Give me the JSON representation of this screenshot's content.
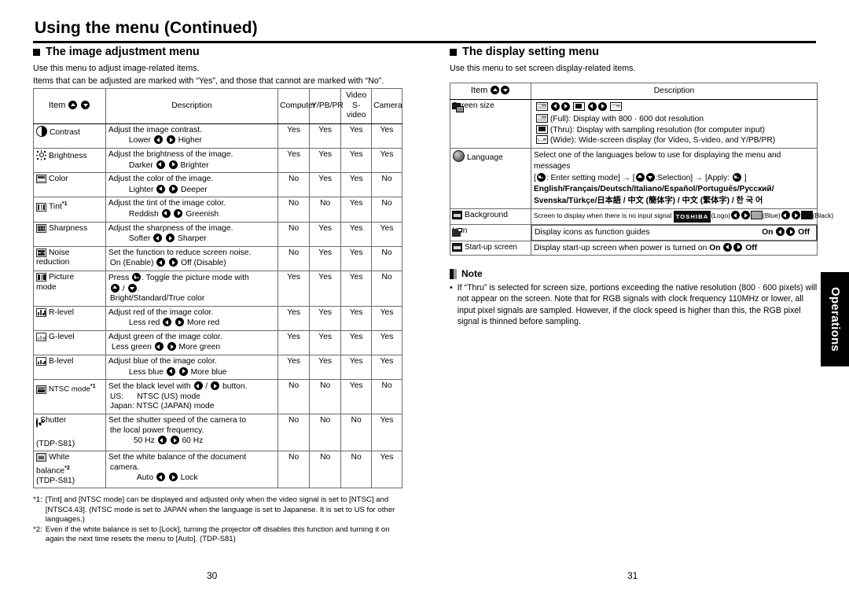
{
  "header": {
    "title": "Using the menu (Continued)"
  },
  "left": {
    "section_title": "The image adjustment menu",
    "intro_line1": "Use this menu to adjust image-related items.",
    "intro_line2": "Items that can be adjusted are marked with  “Yes”, and those that cannot are marked with “No”.",
    "table": {
      "headers": {
        "item": "Item",
        "description": "Description",
        "computer": "Computer",
        "ypbpr": "Y/PB/PR",
        "video_line1": "Video",
        "video_line2": "S-video",
        "camera": "Camera"
      },
      "rows": [
        {
          "icon": "contrast-icon",
          "name": "Contrast",
          "desc_line1": "Adjust the image contrast.",
          "opt_left": "Lower",
          "opt_right": "Higher",
          "computer": "Yes",
          "ypbpr": "Yes",
          "video": "Yes",
          "camera": "Yes"
        },
        {
          "icon": "brightness-icon",
          "name": "Brightness",
          "desc_line1": "Adjust the brightness of the image.",
          "opt_left": "Darker",
          "opt_right": "Brighter",
          "computer": "Yes",
          "ypbpr": "Yes",
          "video": "Yes",
          "camera": "Yes"
        },
        {
          "icon": "color-icon",
          "name": "Color",
          "desc_line1": "Adjust the color of the image.",
          "opt_left": "Lighter",
          "opt_right": "Deeper",
          "computer": "No",
          "ypbpr": "Yes",
          "video": "Yes",
          "camera": "No"
        },
        {
          "icon": "tint-icon",
          "name": "Tint",
          "footnote_mark": "*1",
          "desc_line1": "Adjust the tint of the image color.",
          "opt_left": "Reddish",
          "opt_right": "Greenish",
          "computer": "No",
          "ypbpr": "No",
          "video": "Yes",
          "camera": "No"
        },
        {
          "icon": "sharpness-icon",
          "name": "Sharpness",
          "desc_line1": "Adjust the sharpness of the image.",
          "opt_left": "Softer",
          "opt_right": "Sharper",
          "computer": "No",
          "ypbpr": "Yes",
          "video": "Yes",
          "camera": "Yes"
        },
        {
          "icon": "noise-reduction-icon",
          "name": "Noise",
          "name_line2": "reduction",
          "desc_line1": "Set the function to reduce screen noise.",
          "opt_left": "On (Enable)",
          "opt_right": "Off (Disable)",
          "computer": "No",
          "ypbpr": "Yes",
          "video": "Yes",
          "camera": "No"
        },
        {
          "icon": "picture-mode-icon",
          "name": "Picture",
          "name_line2": "mode",
          "desc_pre": "Press",
          "desc_post": ". Toggle the picture mode with",
          "desc_line3": "Bright/Standard/True color",
          "computer": "Yes",
          "ypbpr": "Yes",
          "video": "Yes",
          "camera": "No"
        },
        {
          "icon": "r-level-icon",
          "name": "R-level",
          "desc_line1": "Adjust red of the image color.",
          "opt_left": "Less red",
          "opt_right": "More red",
          "computer": "Yes",
          "ypbpr": "Yes",
          "video": "Yes",
          "camera": "Yes"
        },
        {
          "icon": "g-level-icon",
          "name": "G-level",
          "desc_line1": "Adjust green of the image color.",
          "opt_left": "Less green",
          "opt_right": "More green",
          "computer": "Yes",
          "ypbpr": "Yes",
          "video": "Yes",
          "camera": "Yes"
        },
        {
          "icon": "b-level-icon",
          "name": "B-level",
          "desc_line1": "Adjust blue of the image color.",
          "opt_left": "Less blue",
          "opt_right": "More blue",
          "computer": "Yes",
          "ypbpr": "Yes",
          "video": "Yes",
          "camera": "Yes"
        },
        {
          "icon": "ntsc-mode-icon",
          "name": "NTSC mode",
          "footnote_mark": "*1",
          "desc_pre": "Set the black level with",
          "desc_post": "button.",
          "desc_line2": "US:      NTSC (US) mode",
          "desc_line3": "Japan:  NTSC (JAPAN) mode",
          "computer": "No",
          "ypbpr": "No",
          "video": "Yes",
          "camera": "No"
        },
        {
          "icon": "shutter-icon",
          "name": "Shutter",
          "model": "(TDP-S81)",
          "desc_line1": "Set the shutter speed of the camera to",
          "desc_line2": "the local power frequency.",
          "opt_left": "50 Hz",
          "opt_right": "60 Hz",
          "computer": "No",
          "ypbpr": "No",
          "video": "No",
          "camera": "Yes"
        },
        {
          "icon": "white-balance-icon",
          "name": "White",
          "name_line2": "balance",
          "footnote_mark": "*2",
          "model": "(TDP-S81)",
          "desc_line1": "Set the white balance of the document",
          "desc_line2": "camera.",
          "opt_left": "Auto",
          "opt_right": "Lock",
          "computer": "No",
          "ypbpr": "No",
          "video": "No",
          "camera": "Yes"
        }
      ]
    },
    "footnotes": [
      {
        "mark": "*1:",
        "text": "[Tint] and [NTSC mode] can be displayed and adjusted only when the video signal is set to [NTSC] and [NTSC4.43]. (NTSC mode is set to JAPAN when the language is set to Japanese. It is set to US for other languages.)"
      },
      {
        "mark": "*2:",
        "text": "Even if the white balance is set to [Lock], turning  the projector off disables this function and turning it on again the next time resets the menu to [Auto]. (TDP-S81)"
      }
    ],
    "page_number": "30"
  },
  "right": {
    "section_title": "The display setting menu",
    "intro_line1": "Use this menu to set screen display-related items.",
    "table": {
      "headers": {
        "item": "Item",
        "description": "Description"
      },
      "rows": [
        {
          "icon": "screen-size-icon",
          "name": "Screen size",
          "full_label": "(Full):",
          "full_text": "Display with 800 ·   600 dot resolution",
          "thru_label": "(Thru):",
          "thru_text": "Display with sampling resolution (for computer input)",
          "wide_label": "(Wide):",
          "wide_text": "Wide-screen display (for Video, S-video, and Y/PB/PR)"
        },
        {
          "icon": "language-icon",
          "name": "Language",
          "desc_line1": "Select one of the languages below to use for displaying the menu and messages",
          "desc_line2_a": "[",
          "desc_line2_b": ": Enter setting mode] → [",
          "desc_line2_c": ":Selection] → [Apply:",
          "desc_line2_d": "]",
          "languages_line1": "English/Français/Deutsch/Italiano/Español/Português/Русский/",
          "languages_line2": "Svenska/Türkçe/日本語 / 中文 (簡体字) / 中文 (繁体字) / 한 국 어"
        },
        {
          "icon": "background-icon",
          "name": "Background",
          "desc_pre": "Screen to display when there is no input signal",
          "logo_chip": "TOSHIBA",
          "logo_label": "(Logo)",
          "blue_label": "(Blue)",
          "black_label": "(Black)"
        },
        {
          "icon": "icon-guide-icon",
          "name": "Icon",
          "desc_line1": "Display icons as function guides",
          "opt_left": "On",
          "opt_right": "Off"
        },
        {
          "icon": "startup-screen-icon",
          "name": "Start-up screen",
          "desc_line1": "Display start-up screen when power is turned on",
          "opt_left": "On",
          "opt_right": "Off"
        }
      ]
    },
    "note": {
      "heading": "Note",
      "bullet": "•",
      "text": "If “Thru” is selected for screen size, portions exceeding the native resolution (800 ·   600 pixels) will not appear on the screen. Note that for RGB signals with clock frequency 110MHz or lower, all input pixel signals are sampled. However, if the clock speed is higher than this, the RGB pixel signal is thinned before sampling.",
      "bold_phrase": "screen size"
    },
    "page_number": "31"
  },
  "side_tab": {
    "label": "Operations"
  }
}
